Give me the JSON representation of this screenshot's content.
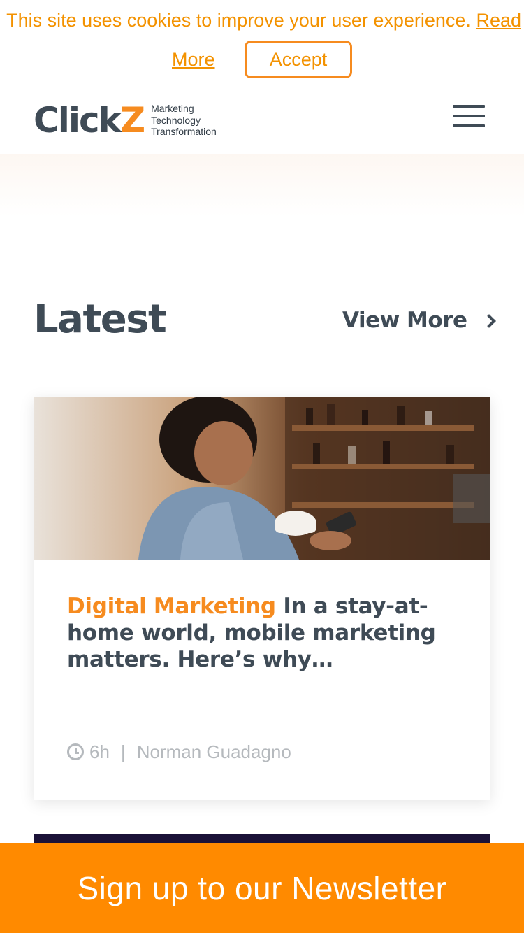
{
  "cookie": {
    "text": "This site uses cookies to improve your user experience. ",
    "read": "Read",
    "more": "More",
    "accept": "Accept"
  },
  "header": {
    "logo_main": "Click",
    "logo_z": "Z",
    "tagline": [
      "Marketing",
      "Technology",
      "Transformation"
    ],
    "menu_icon": "hamburger-menu-icon"
  },
  "latest": {
    "title": "Latest",
    "view_more": "View More"
  },
  "article": {
    "category": "Digital Marketing",
    "title": "In a stay-at-home world, mobile marketing matters. Here’s why…",
    "age": "6h",
    "separator": "|",
    "author": "Norman Guadagno",
    "image_icon": "woman-with-coffee-and-phone-photo"
  },
  "newsletter": {
    "label": "Sign up to our Newsletter"
  },
  "colors": {
    "accent": "#f68b1f",
    "newsletter_bg": "#ff8a00",
    "text_dark": "#3f4b56",
    "meta": "#b5b9bd"
  }
}
